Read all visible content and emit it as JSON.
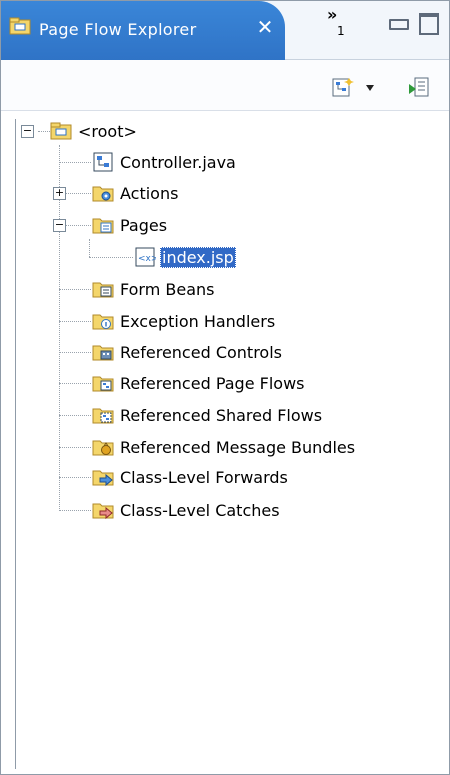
{
  "view": {
    "title": "Page Flow Explorer",
    "close_symbol": "✕",
    "overflow_count": "1"
  },
  "tree": {
    "root": "<root>",
    "controller": "Controller.java",
    "actions": "Actions",
    "pages": "Pages",
    "index": "index.jsp",
    "form_beans": "Form Beans",
    "exception_handlers": "Exception Handlers",
    "ref_controls": "Referenced Controls",
    "ref_page_flows": "Referenced Page Flows",
    "ref_shared_flows": "Referenced Shared Flows",
    "ref_message_bundles": "Referenced Message Bundles",
    "class_forwards": "Class-Level Forwards",
    "class_catches": "Class-Level Catches",
    "selected": "index.jsp"
  },
  "colors": {
    "tab_blue": "#2f73c6",
    "selection": "#3169c6",
    "folder": "#f4d66b"
  },
  "icons": {
    "tab": "page-flow-icon",
    "toolbar_new": "new-page-flow-icon",
    "toolbar_run": "run-icon"
  }
}
